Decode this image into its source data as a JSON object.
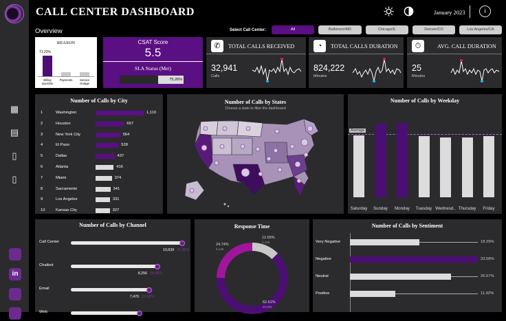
{
  "header": {
    "title": "CALL CENTER DASHBOARD",
    "overview": "Overview",
    "month": "January 2023",
    "info": "i",
    "select_label": "Select Call Center:"
  },
  "filters": [
    "All",
    "Baltimore/MD",
    "Chicago/IL",
    "Denver/CO",
    "Los Angeles/CA"
  ],
  "reason": {
    "title": "REASON",
    "pct": "71.22%",
    "categories": [
      "Billing\nQuestion",
      "Payments",
      "Service\nOutage"
    ],
    "values": [
      71.22,
      12,
      12
    ]
  },
  "csat": {
    "title": "CSAT Score",
    "value": "5.5",
    "sla_title": "SLA Status (Met)",
    "sla_pct": "75.26%",
    "sla_fraction": 0.7526
  },
  "kpis": [
    {
      "icon": "phone-icon",
      "glyph": "✆",
      "title": "TOTAL CALLS RECEIVED",
      "value": "32,941",
      "sub": "Calls"
    },
    {
      "icon": "clock-icon",
      "glyph": "◔",
      "title": "TOTAL CALLS DURATION",
      "value": "824,222",
      "sub": "Minutes"
    },
    {
      "icon": "timer-icon",
      "glyph": "⏱",
      "title": "AVG. CALL DURATION",
      "value": "25",
      "sub": "Minutes"
    }
  ],
  "city": {
    "title": "Number of Calls by City",
    "rows": [
      {
        "rank": "1",
        "name": "Washington",
        "value": "1,110",
        "n": 1110
      },
      {
        "rank": "2",
        "name": "Houston",
        "value": "657",
        "n": 657
      },
      {
        "rank": "3",
        "name": "New York City",
        "value": "564",
        "n": 564
      },
      {
        "rank": "4",
        "name": "El Paso",
        "value": "528",
        "n": 528
      },
      {
        "rank": "5",
        "name": "Dallas",
        "value": "437",
        "n": 437
      },
      {
        "rank": "6",
        "name": "Atlanta",
        "value": "416",
        "n": 416
      },
      {
        "rank": "7",
        "name": "Miami",
        "value": "374",
        "n": 374
      },
      {
        "rank": "8",
        "name": "Sacramento",
        "value": "341",
        "n": 341
      },
      {
        "rank": "9",
        "name": "Los Angeles",
        "value": "331",
        "n": 331
      },
      {
        "rank": "10",
        "name": "Kansas City",
        "value": "327",
        "n": 327
      }
    ]
  },
  "states": {
    "title": "Number of Calls by States",
    "subtitle": "Choose a state to filter the dashboard"
  },
  "weekday": {
    "title": "Number of Calls by Weekday",
    "avg_label": "Average",
    "days": [
      "Saturday",
      "Sunday",
      "Monday",
      "Tuesday",
      "Wednesd..",
      "Thursday",
      "Friday"
    ],
    "values": [
      4600,
      5450,
      5500,
      4550,
      4450,
      4450,
      4550
    ],
    "highlight": [
      false,
      true,
      true,
      false,
      false,
      false,
      false
    ],
    "average": 4700,
    "ymax": 5800
  },
  "channel": {
    "title": "Number of Calls by Channel",
    "rows": [
      {
        "name": "Call Center",
        "value": "10,639",
        "pct": "32.30%",
        "frac": 1.0
      },
      {
        "name": "Chatbot",
        "value": "8,256",
        "pct": "25.06%",
        "frac": 0.776
      },
      {
        "name": "Email",
        "value": "7,470",
        "pct": "22.68%",
        "frac": 0.702
      },
      {
        "name": "Web",
        "value": "",
        "pct": "",
        "frac": 0.62
      }
    ]
  },
  "response": {
    "title": "Response Time",
    "segments": [
      {
        "pct": "12.65%",
        "count": "4,168",
        "value": 12.65,
        "color": "#c8c8c8"
      },
      {
        "pct": "62.61%",
        "count": "20,625",
        "value": 62.61,
        "color": "#4b0f73"
      },
      {
        "pct": "24.74%",
        "count": "8,148",
        "value": 24.74,
        "color": "#a0159a"
      }
    ]
  },
  "sentiment": {
    "title": "Number of Calls by Sentiment",
    "rows": [
      {
        "name": "Very Negative",
        "pct": "18.29%",
        "value": 18.29,
        "highlight": false
      },
      {
        "name": "Negative",
        "pct": "33.58%",
        "value": 33.58,
        "highlight": true
      },
      {
        "name": "Neutral",
        "pct": "26.57%",
        "value": 26.57,
        "highlight": false
      },
      {
        "name": "Positive",
        "pct": "11.92%",
        "value": 11.92,
        "highlight": false
      }
    ]
  },
  "sidebar": [
    "dashboard-icon",
    "table-icon",
    "pdf-icon",
    "ppt-icon"
  ],
  "social": [
    "database-icon",
    "linkedin-icon",
    "network-icon",
    "person-icon"
  ]
}
